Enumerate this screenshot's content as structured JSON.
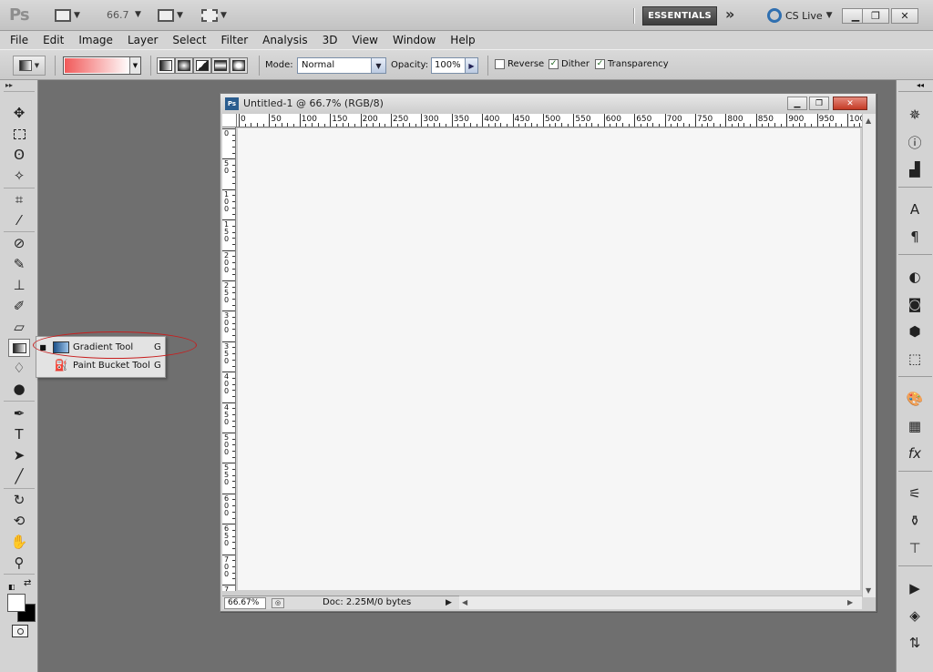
{
  "app": {
    "logo": "Ps",
    "zoom_level": "66.7",
    "workspace": "ESSENTIALS",
    "more_workspaces": "»",
    "cs_live": "CS Live"
  },
  "menu": [
    "File",
    "Edit",
    "Image",
    "Layer",
    "Select",
    "Filter",
    "Analysis",
    "3D",
    "View",
    "Window",
    "Help"
  ],
  "options": {
    "gradient_colors": [
      "#f15a5a",
      "#ffffff"
    ],
    "mode_label": "Mode:",
    "mode_value": "Normal",
    "opacity_label": "Opacity:",
    "opacity_value": "100%",
    "reverse_label": "Reverse",
    "reverse_checked": false,
    "dither_label": "Dither",
    "dither_checked": true,
    "transparency_label": "Transparency",
    "transparency_checked": true
  },
  "flyout": {
    "items": [
      {
        "label": "Gradient Tool",
        "shortcut": "G",
        "active": true,
        "icon": "gradient-icon"
      },
      {
        "label": "Paint Bucket Tool",
        "shortcut": "G",
        "active": false,
        "icon": "paint-bucket-icon"
      }
    ],
    "highlight_color": "#c81e1e"
  },
  "document": {
    "title": "Untitled-1 @ 66.7% (RGB/8)",
    "ruler_h": [
      "0",
      "50",
      "100",
      "150",
      "200",
      "250",
      "300",
      "350",
      "400",
      "450",
      "500",
      "550",
      "600",
      "650",
      "700",
      "750",
      "800",
      "850",
      "900",
      "950",
      "100"
    ],
    "ruler_v": [
      "0",
      "50",
      "100",
      "150",
      "200",
      "250",
      "300",
      "350",
      "400",
      "450",
      "500",
      "550",
      "600",
      "650",
      "700",
      "7"
    ],
    "status_zoom": "66.67%",
    "doc_info": "Doc: 2.25M/0 bytes"
  }
}
